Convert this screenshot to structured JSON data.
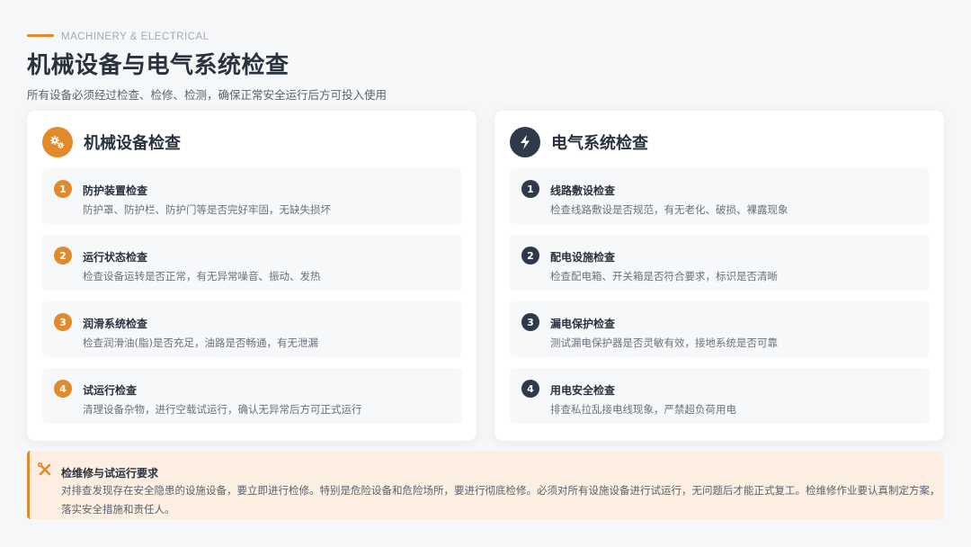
{
  "header": {
    "eyebrow": "MACHINERY & ELECTRICAL",
    "title": "机械设备与电气系统检查",
    "subtitle": "所有设备必须经过检查、检修、检测，确保正常安全运行后方可投入使用"
  },
  "mechanical": {
    "icon": "gears-icon",
    "title": "机械设备检查",
    "items": [
      {
        "num": "1",
        "title": "防护装置检查",
        "desc": "防护罩、防护栏、防护门等是否完好牢固，无缺失损坏"
      },
      {
        "num": "2",
        "title": "运行状态检查",
        "desc": "检查设备运转是否正常，有无异常噪音、振动、发热"
      },
      {
        "num": "3",
        "title": "润滑系统检查",
        "desc": "检查润滑油(脂)是否充足，油路是否畅通，有无泄漏"
      },
      {
        "num": "4",
        "title": "试运行检查",
        "desc": "清理设备杂物，进行空载试运行，确认无异常后方可正式运行"
      }
    ]
  },
  "electrical": {
    "icon": "lightning-icon",
    "title": "电气系统检查",
    "items": [
      {
        "num": "1",
        "title": "线路敷设检查",
        "desc": "检查线路敷设是否规范，有无老化、破损、裸露现象"
      },
      {
        "num": "2",
        "title": "配电设施检查",
        "desc": "检查配电箱、开关箱是否符合要求，标识是否清晰"
      },
      {
        "num": "3",
        "title": "漏电保护检查",
        "desc": "测试漏电保护器是否灵敏有效，接地系统是否可靠"
      },
      {
        "num": "4",
        "title": "用电安全检查",
        "desc": "排查私拉乱接电线现象，严禁超负荷用电"
      }
    ]
  },
  "notice": {
    "icon": "tools-icon",
    "title": "检维修与试运行要求",
    "text": "对排查发现存在安全隐患的设施设备，要立即进行检修。特别是危险设备和危险场所，要进行彻底检修。必须对所有设施设备进行试运行，无问题后才能正式复工。检维修作业要认真制定方案，落实安全措施和责任人。"
  },
  "colors": {
    "accent": "#e08a2c",
    "dark": "#2e3a4a",
    "notice_bg": "#fcefe2"
  }
}
